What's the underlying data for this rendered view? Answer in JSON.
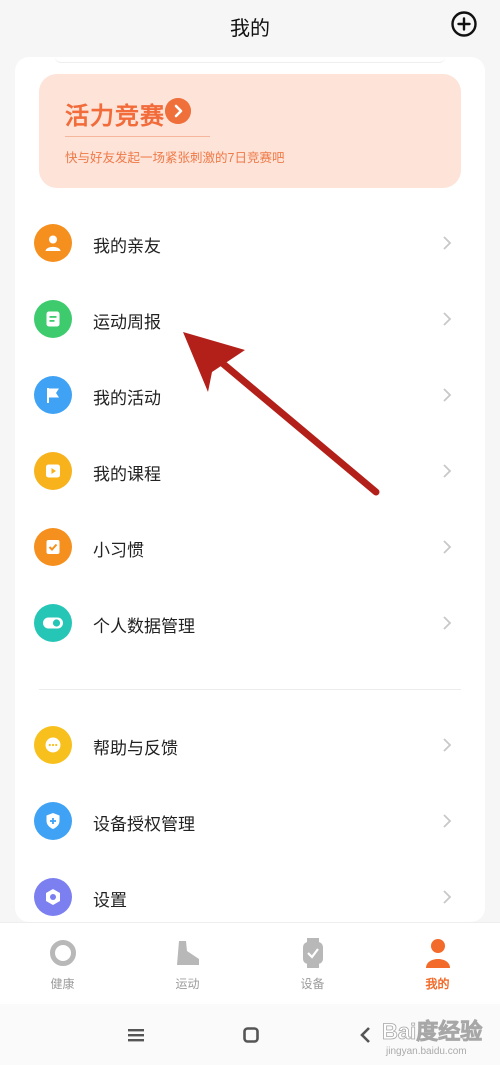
{
  "header": {
    "title": "我的"
  },
  "banner": {
    "title": "活力竞赛",
    "subtitle": "快与好友发起一场紧张刺激的7日竞赛吧"
  },
  "menu_group1": [
    {
      "label": "我的亲友",
      "icon": "person-icon",
      "color": "#f5901e"
    },
    {
      "label": "运动周报",
      "icon": "report-icon",
      "color": "#3ecb6e"
    },
    {
      "label": "我的活动",
      "icon": "flag-icon",
      "color": "#3fa2f4"
    },
    {
      "label": "我的课程",
      "icon": "play-icon",
      "color": "#f7b21c"
    },
    {
      "label": "小习惯",
      "icon": "check-icon",
      "color": "#f5901e"
    },
    {
      "label": "个人数据管理",
      "icon": "toggle-icon",
      "color": "#26c6b7"
    }
  ],
  "menu_group2": [
    {
      "label": "帮助与反馈",
      "icon": "chat-icon",
      "color": "#f8c01c"
    },
    {
      "label": "设备授权管理",
      "icon": "shield-icon",
      "color": "#3fa2f4"
    },
    {
      "label": "设置",
      "icon": "gear-icon",
      "color": "#7b7ff0"
    }
  ],
  "bottom_nav": [
    {
      "label": "健康",
      "icon": "ring-icon",
      "active": false
    },
    {
      "label": "运动",
      "icon": "shoe-icon",
      "active": false
    },
    {
      "label": "设备",
      "icon": "watch-icon",
      "active": false
    },
    {
      "label": "我的",
      "icon": "user-icon",
      "active": true
    }
  ],
  "colors": {
    "accent": "#f26b2a",
    "banner_bg": "#fde3d8",
    "annotation_arrow": "#b3201a"
  },
  "watermark": {
    "text": "Bai度经验",
    "subtext": "jingyan.baidu.com"
  }
}
